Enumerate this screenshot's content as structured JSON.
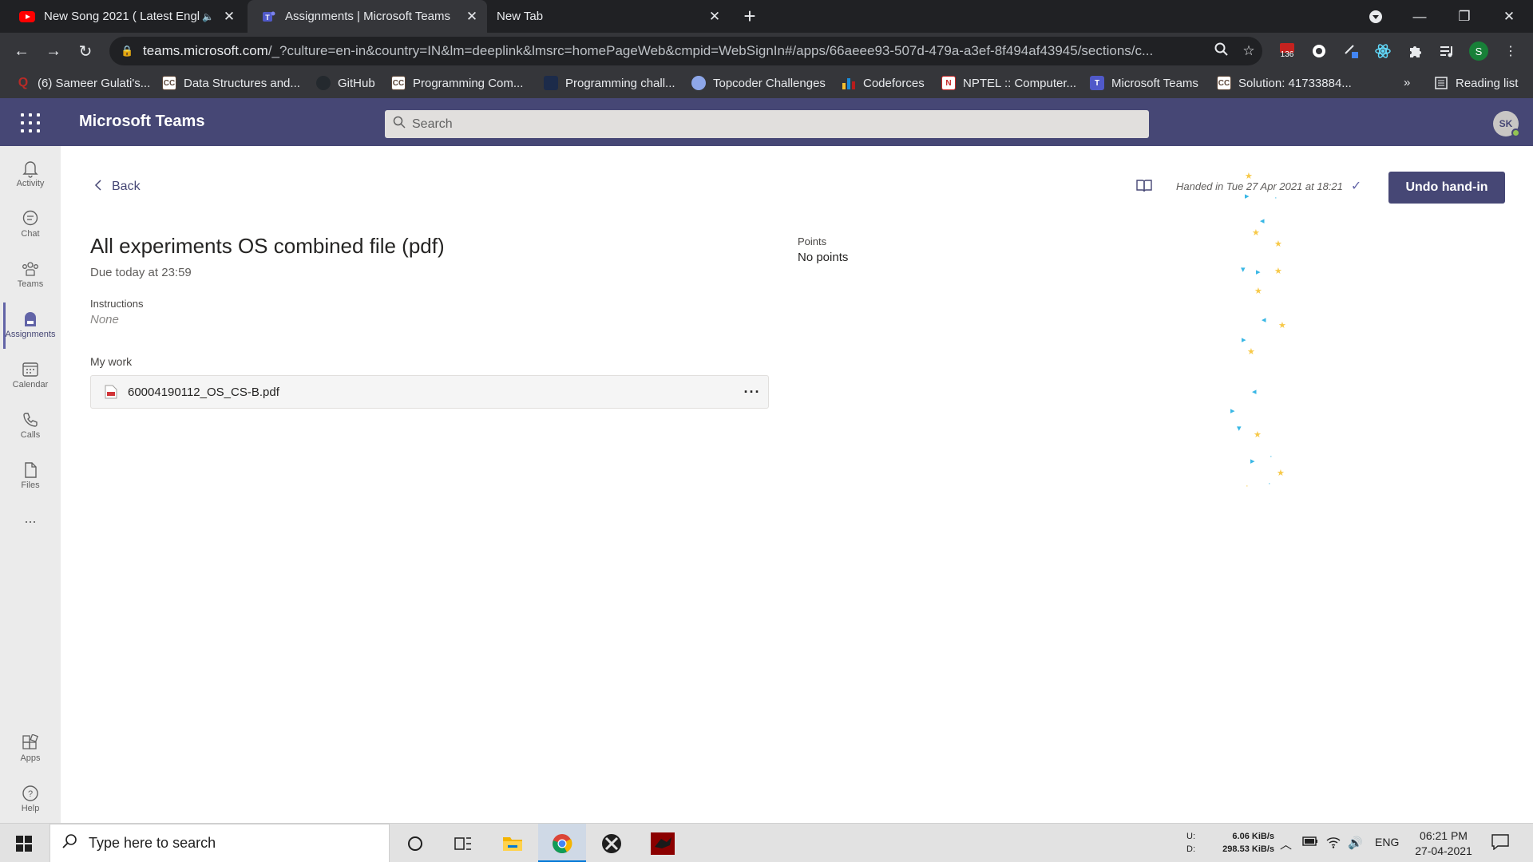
{
  "browser": {
    "tabs": [
      {
        "title": "New Song 2021 ( Latest Engl",
        "favicon": "youtube-icon",
        "audio": true
      },
      {
        "title": "Assignments | Microsoft Teams",
        "favicon": "teams-icon",
        "active": true
      },
      {
        "title": "New Tab",
        "favicon": ""
      }
    ],
    "url_host": "teams.microsoft.com",
    "url_rest": "/_?culture=en-in&country=IN&lm=deeplink&lmsrc=homePageWeb&cmpid=WebSignIn#/apps/66aeee93-507d-479a-a3ef-8f494af43945/sections/c...",
    "extension_badge": "136",
    "profile_initial": "S",
    "bookmarks": [
      {
        "label": "(6) Sameer Gulati's...",
        "icon": "quora-icon"
      },
      {
        "label": "Data Structures and...",
        "icon": "codechef-icon"
      },
      {
        "label": "GitHub",
        "icon": "github-icon"
      },
      {
        "label": "Programming Com...",
        "icon": "codechef-icon"
      },
      {
        "label": "Programming chall...",
        "icon": "hackerrank-icon"
      },
      {
        "label": "Topcoder Challenges",
        "icon": "topcoder-icon"
      },
      {
        "label": "Codeforces",
        "icon": "codeforces-icon"
      },
      {
        "label": "NPTEL :: Computer...",
        "icon": "nptel-icon"
      },
      {
        "label": "Microsoft Teams",
        "icon": "teams-icon"
      },
      {
        "label": "Solution: 41733884...",
        "icon": "codechef-icon"
      }
    ],
    "bookmarks_overflow": "»",
    "reading_list": "Reading list"
  },
  "teams": {
    "app_name": "Microsoft Teams",
    "search_placeholder": "Search",
    "avatar_initials": "SK",
    "rail": [
      {
        "label": "Activity",
        "icon": "bell-icon"
      },
      {
        "label": "Chat",
        "icon": "chat-icon"
      },
      {
        "label": "Teams",
        "icon": "teams-people-icon"
      },
      {
        "label": "Assignments",
        "icon": "backpack-icon",
        "active": true
      },
      {
        "label": "Calendar",
        "icon": "calendar-icon"
      },
      {
        "label": "Calls",
        "icon": "phone-icon"
      },
      {
        "label": "Files",
        "icon": "file-icon"
      }
    ],
    "rail_more": "...",
    "rail_bottom": [
      {
        "label": "Apps",
        "icon": "apps-icon"
      },
      {
        "label": "Help",
        "icon": "help-icon"
      }
    ]
  },
  "assignment": {
    "back_label": "Back",
    "handed_in_text": "Handed in Tue 27 Apr 2021 at 18:21",
    "undo_label": "Undo hand-in",
    "title": "All experiments OS combined file (pdf)",
    "due": "Due today at 23:59",
    "instructions_label": "Instructions",
    "instructions_value": "None",
    "points_label": "Points",
    "points_value": "No points",
    "my_work_label": "My work",
    "file_name": "60004190112_OS_CS-B.pdf",
    "file_more": "···"
  },
  "taskbar": {
    "search_placeholder": "Type here to search",
    "upload_label": "U:",
    "upload_speed": "6.06 KiB/s",
    "download_label": "D:",
    "download_speed": "298.53 KiB/s",
    "language": "ENG",
    "time": "06:21 PM",
    "date": "27-04-2021"
  },
  "colors": {
    "teams_header": "#464775",
    "teams_accent": "#6264a7",
    "chrome_dark": "#202124",
    "chrome_toolbar": "#35363a"
  }
}
